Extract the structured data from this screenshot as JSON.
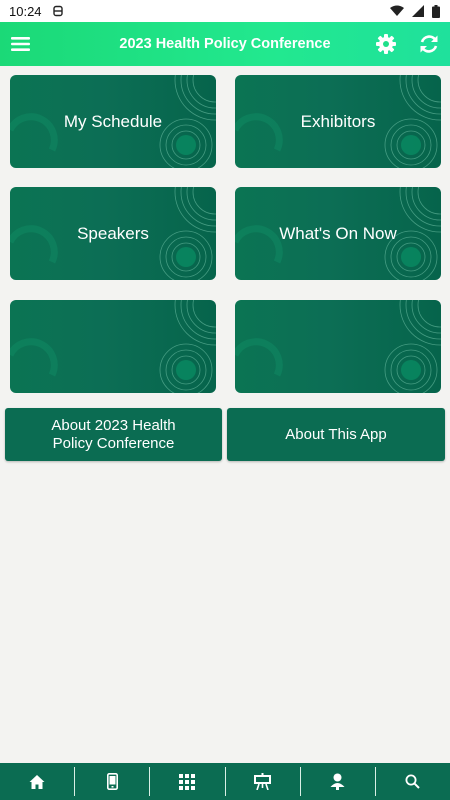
{
  "status_bar": {
    "time": "10:24"
  },
  "app_bar": {
    "title": "2023 Health Policy Conference"
  },
  "tiles": [
    {
      "label": "My Schedule"
    },
    {
      "label": "Exhibitors"
    },
    {
      "label": "Speakers"
    },
    {
      "label": "What's On Now"
    },
    {
      "label": ""
    },
    {
      "label": ""
    }
  ],
  "buttons": {
    "about_conference": "About 2023 Health Policy Conference",
    "about_app": "About This App"
  },
  "bottom_nav": [
    "home-icon",
    "phone-icon",
    "grid-icon",
    "easel-icon",
    "person-icon",
    "search-icon"
  ],
  "colors": {
    "app_bar": "#1bd977",
    "tile": "#0b7453",
    "button": "#0b6c52",
    "background": "#f3f3f1"
  }
}
